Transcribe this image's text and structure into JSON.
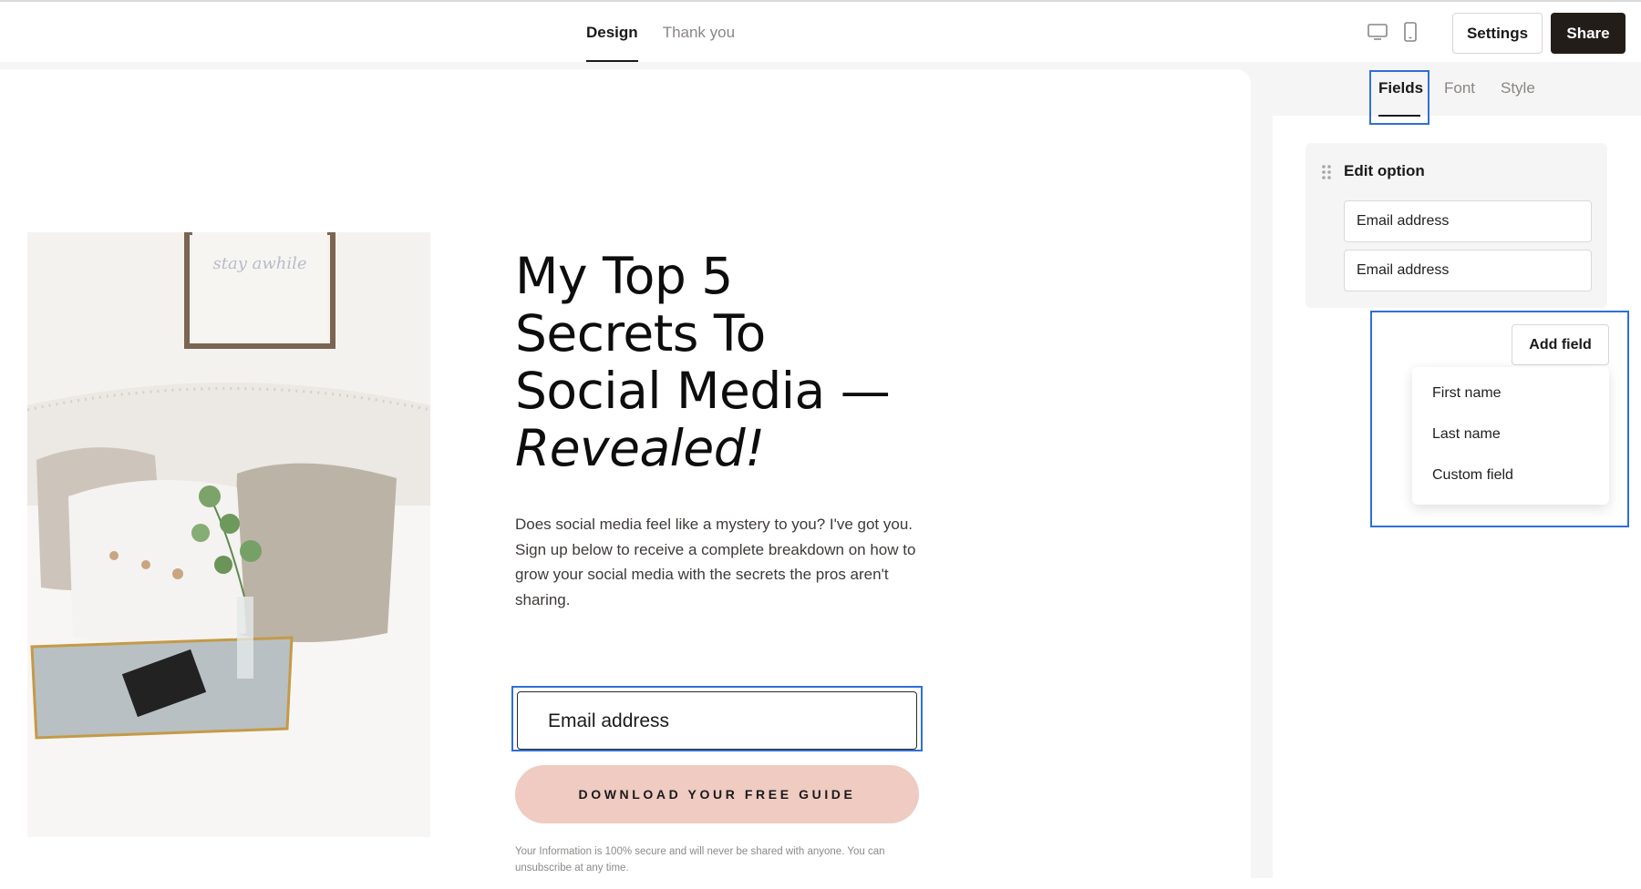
{
  "top_tabs": [
    {
      "label": "Design",
      "active": true
    },
    {
      "label": "Thank you",
      "active": false
    }
  ],
  "header": {
    "device_icons": [
      "desktop-icon",
      "mobile-icon"
    ],
    "settings_label": "Settings",
    "share_label": "Share"
  },
  "page": {
    "headline_lines": [
      "My Top 5",
      "Secrets To",
      "Social Media —"
    ],
    "headline_italic": "Revealed!",
    "paragraph": "Does social media feel like a mystery to you? I've got you. Sign up below to receive a complete breakdown on how to grow your social media with the secrets the pros aren't sharing.",
    "email_placeholder": "Email address",
    "cta_label": "DOWNLOAD YOUR FREE GUIDE",
    "disclaimer": "Your Information is 100% secure and will never be shared with anyone. You can unsubscribe at any time.",
    "photo_sign_text": "stay awhile"
  },
  "panel": {
    "tabs": [
      {
        "label": "Fields",
        "active": true
      },
      {
        "label": "Font",
        "active": false
      },
      {
        "label": "Style",
        "active": false
      }
    ],
    "edit_option_title": "Edit option",
    "option_inputs": [
      "Email address",
      "Email address"
    ],
    "add_field_label": "Add field",
    "add_field_menu": [
      "First name",
      "Last name",
      "Custom field"
    ]
  },
  "colors": {
    "accent_selection": "#2f6fd6",
    "share_button": "#231d19",
    "cta_button": "#efcbc2"
  }
}
